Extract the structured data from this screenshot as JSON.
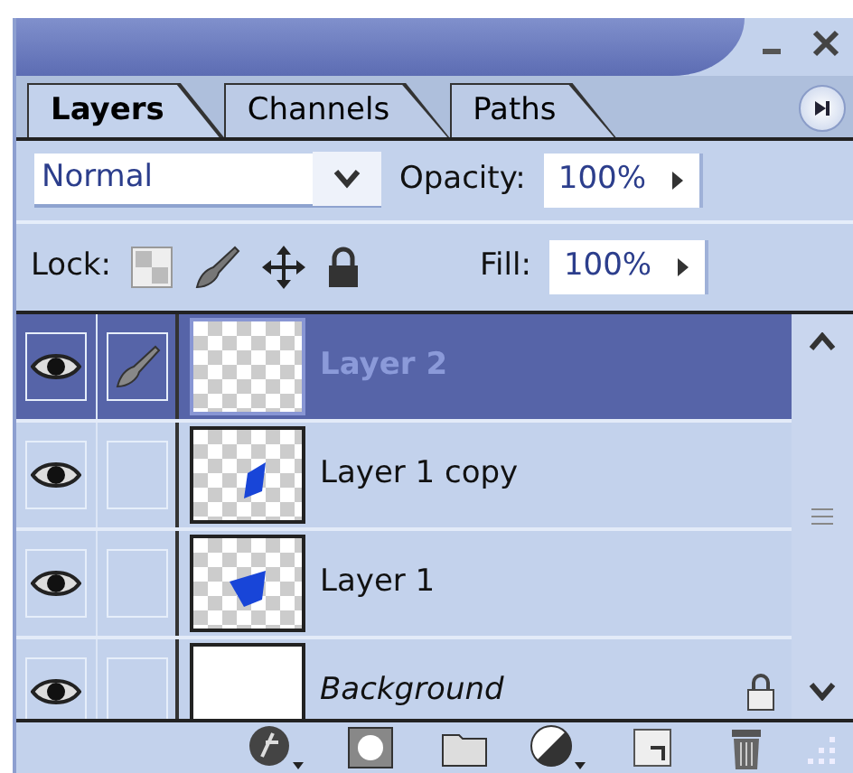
{
  "tabs": [
    {
      "label": "Layers",
      "selected": true
    },
    {
      "label": "Channels",
      "selected": false
    },
    {
      "label": "Paths",
      "selected": false
    }
  ],
  "blend_mode": {
    "value": "Normal"
  },
  "opacity": {
    "label": "Opacity:",
    "value": "100%"
  },
  "lock": {
    "label": "Lock:"
  },
  "fill": {
    "label": "Fill:",
    "value": "100%"
  },
  "layers": [
    {
      "name": "Layer 2",
      "kind": "layer",
      "selected": true,
      "visible": true,
      "editing": true,
      "locked": false,
      "transparent": true,
      "has_shape": false
    },
    {
      "name": "Layer 1 copy",
      "kind": "layer",
      "selected": false,
      "visible": true,
      "editing": false,
      "locked": false,
      "transparent": true,
      "has_shape": true
    },
    {
      "name": "Layer 1",
      "kind": "layer",
      "selected": false,
      "visible": true,
      "editing": false,
      "locked": false,
      "transparent": true,
      "has_shape": true
    },
    {
      "name": "Background",
      "kind": "background",
      "selected": false,
      "visible": true,
      "editing": false,
      "locked": true,
      "transparent": false,
      "has_shape": false
    }
  ]
}
